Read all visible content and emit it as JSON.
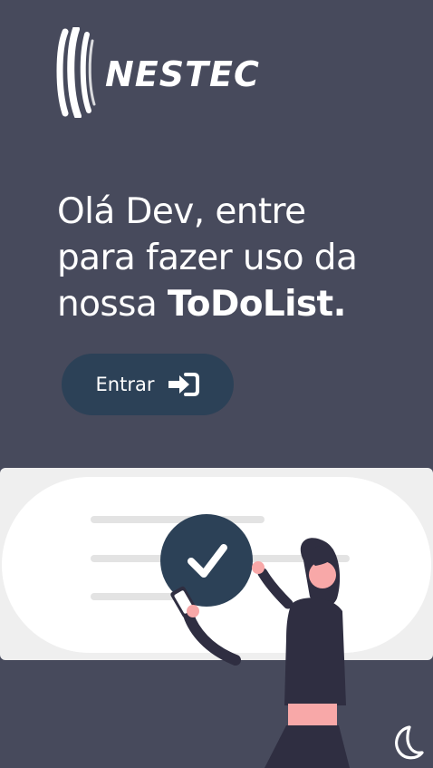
{
  "brand": {
    "logo_text": "NESTEC"
  },
  "hero": {
    "line1": "Olá Dev, entre",
    "line2": "para fazer uso da",
    "line3_prefix": "nossa ",
    "line3_bold": "ToDoList."
  },
  "actions": {
    "enter_label": "Entrar"
  },
  "icons": {
    "logo": "nestec-logo-icon",
    "enter": "sign-in-icon",
    "check": "check-icon",
    "theme": "moon-icon"
  },
  "colors": {
    "background": "#474a5c",
    "button": "#2c4157",
    "panel": "#efefef",
    "accent_pink": "#f8a8a8"
  }
}
